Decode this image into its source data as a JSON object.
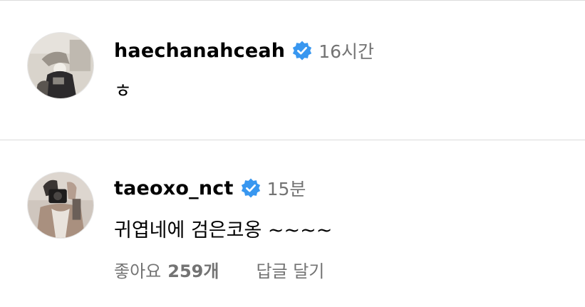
{
  "comments": [
    {
      "username": "haechanahceah",
      "verified": true,
      "timestamp": "16시간",
      "text": "ㅎ",
      "avatar_icon": "profile-photo"
    },
    {
      "username": "taeoxo_nct",
      "verified": true,
      "timestamp": "15분",
      "text": "귀엽네에 검은코옹 ~~~~",
      "avatar_icon": "profile-photo",
      "likes_label": "좋아요",
      "likes_count": "259개",
      "reply_label": "답글 달기"
    }
  ],
  "colors": {
    "verified_badge": "#3897f0",
    "secondary_text": "#737373",
    "divider": "#dbdbdb"
  }
}
